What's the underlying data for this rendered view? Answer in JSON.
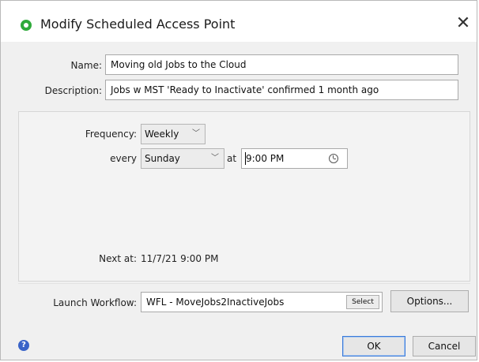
{
  "window": {
    "title": "Modify Scheduled Access Point",
    "close_glyph": "✕",
    "title_icon": "green-circle-icon"
  },
  "details": {
    "name_label": "Name:",
    "name_value": "Moving old Jobs to the Cloud",
    "description_label": "Description:",
    "description_value": "Jobs w MST 'Ready to Inactivate' confirmed 1 month ago"
  },
  "schedule": {
    "frequency_label": "Frequency:",
    "frequency_value": "Weekly",
    "every_label": "every",
    "day_value": "Sunday",
    "at_label": "at",
    "time_value": "9:00 PM",
    "next_at_label": "Next at:",
    "next_at_value": "11/7/21 9:00 PM"
  },
  "workflow": {
    "label": "Launch Workflow:",
    "value": "WFL - MoveJobs2InactiveJobs",
    "select_label": "Select",
    "options_label": "Options..."
  },
  "footer": {
    "help_glyph": "?",
    "ok_label": "OK",
    "cancel_label": "Cancel"
  },
  "colors": {
    "title_icon": "#2eaa3a",
    "default_button_border": "#3b7ad9",
    "help_icon": "#3a64c8"
  }
}
